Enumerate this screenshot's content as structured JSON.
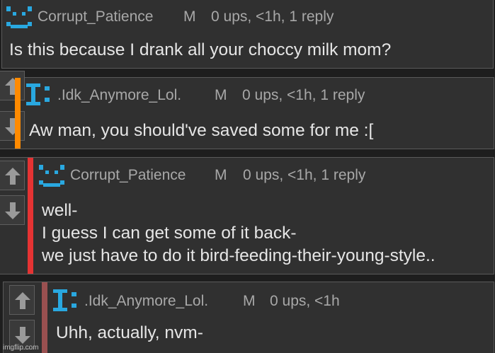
{
  "comments": [
    {
      "username": "Corrupt_Patience",
      "badge": "M",
      "meta": "0 ups, <1h, 1 reply",
      "avatar_icon": "smiley-face-icon",
      "lines": [
        "Is this because I drank all your choccy milk mom?"
      ]
    },
    {
      "username": ".Idk_Anymore_Lol.",
      "badge": "M",
      "meta": "0 ups, <1h, 1 reply",
      "avatar_icon": "i-colon-icon",
      "bar_color": "#ff8a00",
      "lines": [
        "Aw man, you should've saved some for me :["
      ]
    },
    {
      "username": "Corrupt_Patience",
      "badge": "M",
      "meta": "0 ups, <1h, 1 reply",
      "avatar_icon": "smiley-face-icon",
      "bar_color": "#e53333",
      "lines": [
        "well-",
        "I guess I can get some of it back-",
        "we just have to do it bird-feeding-their-young-style.."
      ]
    },
    {
      "username": ".Idk_Anymore_Lol.",
      "badge": "M",
      "meta": "0 ups, <1h",
      "avatar_icon": "i-colon-icon",
      "bar_color": "#9a5050",
      "lines": [
        "Uhh, actually, nvm-"
      ]
    }
  ],
  "watermark": "imgflip.com",
  "colors": {
    "accent_blue": "#29a8e0",
    "background": "#1e1e1e",
    "panel": "#303030"
  }
}
